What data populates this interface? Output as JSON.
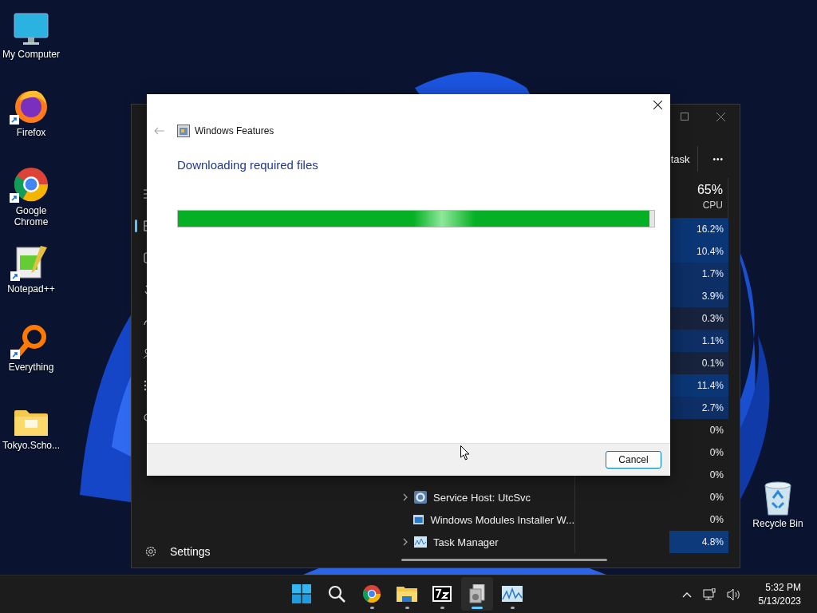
{
  "desktop": {
    "icons": [
      {
        "kind": "computer",
        "label": "My Computer",
        "shortcut": false
      },
      {
        "kind": "firefox",
        "label": "Firefox",
        "shortcut": true
      },
      {
        "kind": "chrome",
        "label": "Google Chrome",
        "shortcut": true
      },
      {
        "kind": "notepad",
        "label": "Notepad++",
        "shortcut": true
      },
      {
        "kind": "search",
        "label": "Everything",
        "shortcut": true
      },
      {
        "kind": "folder",
        "label": "Tokyo.Scho...",
        "shortcut": false
      }
    ],
    "right_icons": [
      {
        "kind": "recycle",
        "label": "Recycle Bin",
        "shortcut": false
      }
    ]
  },
  "task_manager": {
    "command_text": "task",
    "more": "•••",
    "cpu_total": "65%",
    "cpu_label": "CPU",
    "nav": [
      {
        "kind": "menu",
        "selected": false
      },
      {
        "kind": "processes",
        "selected": true
      },
      {
        "kind": "performance",
        "selected": false
      },
      {
        "kind": "history",
        "selected": false
      },
      {
        "kind": "startup",
        "selected": false
      },
      {
        "kind": "users",
        "selected": false
      },
      {
        "kind": "details",
        "selected": false
      },
      {
        "kind": "services",
        "selected": false
      }
    ],
    "settings": "Settings",
    "rows": [
      {
        "cpu": "16.2%",
        "color": "#0b3675"
      },
      {
        "cpu": "10.4%",
        "color": "#0b3675"
      },
      {
        "cpu": "1.7%",
        "color": "#0d2f66"
      },
      {
        "cpu": "3.9%",
        "color": "#0d2f66"
      },
      {
        "cpu": "0.3%",
        "color": "#17233d"
      },
      {
        "cpu": "1.1%",
        "color": "#0d2f66"
      },
      {
        "cpu": "0.1%",
        "color": "#17233d"
      },
      {
        "cpu": "11.4%",
        "color": "#0b3675"
      },
      {
        "cpu": "2.7%",
        "color": "#0d2f66"
      },
      {
        "cpu": "0%",
        "color": "#1c1c1c"
      },
      {
        "cpu": "0%",
        "color": "#1c1c1c"
      },
      {
        "cpu": "0%",
        "color": "#1c1c1c"
      },
      {
        "name": "Service Host: UtcSvc",
        "kind": "service",
        "expandable": true,
        "cpu": "0%",
        "color": "#1c1c1c"
      },
      {
        "name": "Windows Modules Installer W...",
        "kind": "installer",
        "expandable": false,
        "cpu": "0%",
        "color": "#1c1c1c"
      },
      {
        "name": "Task Manager",
        "kind": "taskmgr",
        "expandable": true,
        "cpu": "4.8%",
        "color": "#0d3a7a"
      }
    ]
  },
  "dialog": {
    "title": "Windows Features",
    "heading": "Downloading required files",
    "progress": {
      "level": 0.99
    },
    "buttons": [
      "Cancel"
    ]
  },
  "taskbar": {
    "apps": [
      {
        "kind": "start",
        "running": false,
        "active": false
      },
      {
        "kind": "search",
        "running": false,
        "active": false
      },
      {
        "kind": "chrome",
        "running": true,
        "active": false
      },
      {
        "kind": "explorer",
        "running": true,
        "active": false
      },
      {
        "kind": "archive",
        "running": true,
        "active": false
      },
      {
        "kind": "features",
        "running": true,
        "active": true
      },
      {
        "kind": "taskmgr",
        "running": true,
        "active": false
      }
    ],
    "time": "5:32 PM",
    "date": "5/13/2023"
  }
}
